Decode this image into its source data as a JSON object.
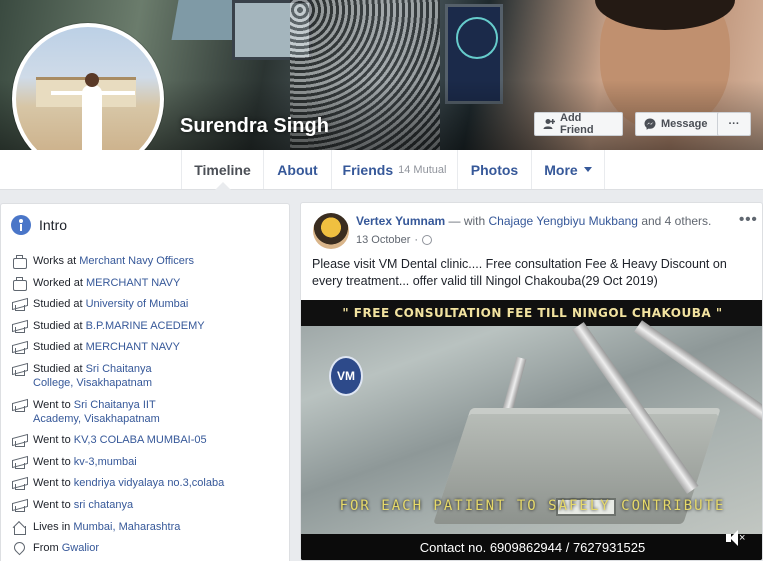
{
  "profile": {
    "name": "Surendra Singh"
  },
  "actions": {
    "add_friend": "Add Friend",
    "message": "Message",
    "more": "···"
  },
  "nav": {
    "timeline": "Timeline",
    "about": "About",
    "friends": "Friends",
    "friends_mutual": "14 Mutual",
    "photos": "Photos",
    "more": "More"
  },
  "intro": {
    "title": "Intro",
    "items": [
      {
        "icon": "briefcase-icon",
        "prefix": "Works at ",
        "link": "Merchant Navy Officers"
      },
      {
        "icon": "briefcase-icon",
        "prefix": "Worked at ",
        "link": "MERCHANT NAVY"
      },
      {
        "icon": "graduation-cap-icon",
        "prefix": "Studied at ",
        "link": "University of Mumbai"
      },
      {
        "icon": "graduation-cap-icon",
        "prefix": "Studied at ",
        "link": "B.P.MARINE ACEDEMY"
      },
      {
        "icon": "graduation-cap-icon",
        "prefix": "Studied at ",
        "link": "MERCHANT NAVY"
      },
      {
        "icon": "graduation-cap-icon",
        "prefix": "Studied at ",
        "link": "Sri Chaitanya College, Visakhapatnam"
      },
      {
        "icon": "graduation-cap-icon",
        "prefix": "Went to ",
        "link": "Sri Chaitanya IIT Academy, Visakhapatnam"
      },
      {
        "icon": "graduation-cap-icon",
        "prefix": "Went to ",
        "link": "KV,3 COLABA MUMBAI-05"
      },
      {
        "icon": "graduation-cap-icon",
        "prefix": "Went to ",
        "link": "kv-3,mumbai"
      },
      {
        "icon": "graduation-cap-icon",
        "prefix": "Went to ",
        "link": "kendriya vidyalaya no.3,colaba"
      },
      {
        "icon": "graduation-cap-icon",
        "prefix": "Went to ",
        "link": "sri chatanya"
      },
      {
        "icon": "home-icon",
        "prefix": "Lives in ",
        "link": "Mumbai, Maharashtra"
      },
      {
        "icon": "location-pin-icon",
        "prefix": "From ",
        "link": "Gwalior"
      }
    ]
  },
  "post": {
    "author": "Vertex Yumnam",
    "with_text": " — with ",
    "tagged": "Chajage Yengbiyu Mukbang",
    "and_others": " and 4 others.",
    "date": "13 October",
    "date_sep": " · ",
    "options": "•••",
    "text": "Please visit VM Dental clinic.... Free consultation Fee & Heavy Discount on every treatment... offer valid till Ningol Chakouba(29 Oct 2019)",
    "video": {
      "banner": "\" FREE CONSULTATION FEE TILL NINGOL CHAKOUBA \"",
      "logo": "VM",
      "caption": "FOR EACH PATIENT TO SAFELY CONTRIBUTE",
      "contact": "Contact no. 6909862944  /  7627931525"
    }
  }
}
